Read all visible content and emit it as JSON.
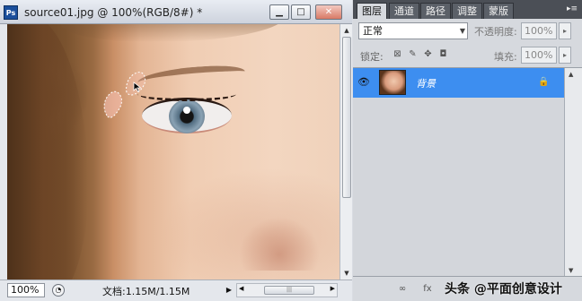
{
  "document": {
    "title": "source01.jpg @ 100%(RGB/8#) *",
    "app_icon": "Ps",
    "zoom": "100%",
    "doc_info": "文档:1.15M/1.15M"
  },
  "window_buttons": {
    "minimize": "▁",
    "maximize": "□",
    "close": "✕"
  },
  "layers_panel": {
    "tabs": [
      "图层",
      "通道",
      "路径",
      "调整",
      "蒙版"
    ],
    "active_tab": "图层",
    "menu_glyph": "▸≡",
    "blend_mode": "正常",
    "opacity_label": "不透明度:",
    "opacity_value": "100%",
    "lock_label": "锁定:",
    "fill_label": "填充:",
    "fill_value": "100%",
    "layers": [
      {
        "name": "背景",
        "visible": true,
        "locked": true
      }
    ]
  },
  "watermark": "头条 @平面创意设计",
  "colors": {
    "selected_layer": "#3d8ef0",
    "tab_bar": "#4b4f56"
  }
}
